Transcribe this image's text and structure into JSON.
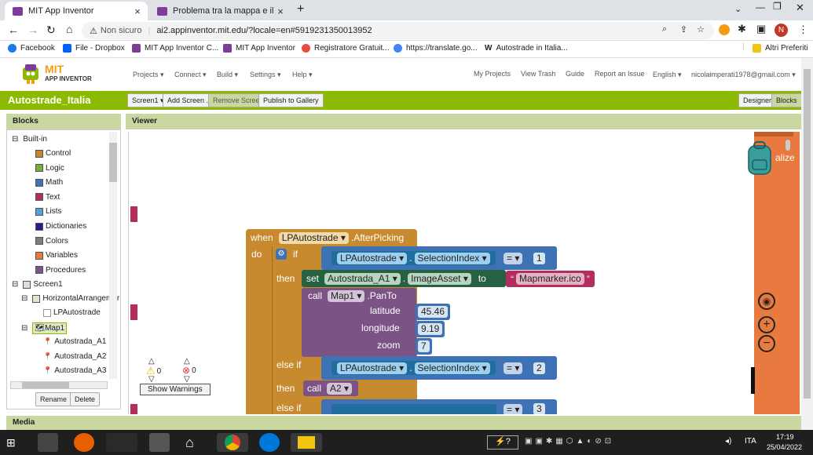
{
  "browser": {
    "tabs": [
      {
        "title": "MIT App Inventor",
        "close": "×"
      },
      {
        "title": "Problema tra la mappa e il marke",
        "close": "×"
      }
    ],
    "new_tab": "+",
    "security": "Non sicuro",
    "url": "ai2.appinventor.mit.edu/?locale=en#5919231350013952",
    "profile_initial": "N",
    "bookmarks": [
      "Facebook",
      "File - Dropbox",
      "MIT App Inventor C...",
      "MIT App Inventor",
      "Registratore Gratuit...",
      "https://translate.go...",
      "Autostrade in Italia..."
    ],
    "bookmarks_other": "Altri Preferiti"
  },
  "ai": {
    "logo_top": "MIT",
    "logo_bottom": "APP INVENTOR",
    "menus": [
      "Projects ▾",
      "Connect ▾",
      "Build ▾",
      "Settings ▾",
      "Help ▾"
    ],
    "right_links": [
      "My Projects",
      "View Trash",
      "Guide",
      "Report an Issue",
      "English ▾",
      "nicolaimperati1978@gmail.com ▾"
    ],
    "project_name": "Autostrade_Italia",
    "toolbar": [
      "Screen1 ▾",
      "Add Screen ...",
      "Remove Screen",
      "Publish to Gallery"
    ],
    "designer_btn": "Designer",
    "blocks_btn": "Blocks",
    "blocks_panel_title": "Blocks",
    "viewer_title": "Viewer",
    "media_title": "Media",
    "tree": {
      "builtin": "Built-in",
      "builtin_items": [
        {
          "label": "Control",
          "color": "#c88330"
        },
        {
          "label": "Logic",
          "color": "#77ab41"
        },
        {
          "label": "Math",
          "color": "#3f71b5"
        },
        {
          "label": "Text",
          "color": "#b32d5e"
        },
        {
          "label": "Lists",
          "color": "#49a6d4"
        },
        {
          "label": "Dictionaries",
          "color": "#2d1799"
        },
        {
          "label": "Colors",
          "color": "#7d7d7d"
        },
        {
          "label": "Variables",
          "color": "#e8793f"
        },
        {
          "label": "Procedures",
          "color": "#7c5385"
        }
      ],
      "screen": "Screen1",
      "arrangement": "HorizontalArrangemer",
      "lp": "LPAutostrade",
      "map": "Map1",
      "markers": [
        "Autostrada_A1",
        "Autostrada_A2",
        "Autostrada_A3"
      ]
    },
    "rename": "Rename",
    "delete": "Delete",
    "warnings_count": "0",
    "errors_count": "0",
    "show_warnings": "Show Warnings",
    "blocks": {
      "when": "when",
      "component": "LPAutostrade",
      "event": ".AfterPicking",
      "do": "do",
      "if": "if",
      "selection_index": "SelectionIndex",
      "equals": "=",
      "v1": "1",
      "then": "then",
      "set": "set",
      "marker": "Autostrada_A1",
      "image_asset": "ImageAsset",
      "to": "to",
      "text_val": "Mapmarker.ico",
      "call": "call",
      "map": "Map1",
      "pan_to": ".PanTo",
      "latitude": "latitude",
      "lat_val": "45.46",
      "longitude": "longitude",
      "lon_val": "9.19",
      "zoom": "zoom",
      "zoom_val": "7",
      "else_if": "else if",
      "v2": "2",
      "proc": "A2",
      "v3": "3",
      "partial_label": "alize"
    }
  },
  "taskbar": {
    "lang": "ITA",
    "time": "17:19",
    "date": "25/04/2022"
  },
  "colors": {
    "ai_green": "#8cba00",
    "event_block": "#c88a2f",
    "component_block": "#1f6e9e",
    "setter_block": "#266141",
    "procedure_block": "#7c5385",
    "text_block": "#b32d5e",
    "math_block": "#3f71b5"
  }
}
